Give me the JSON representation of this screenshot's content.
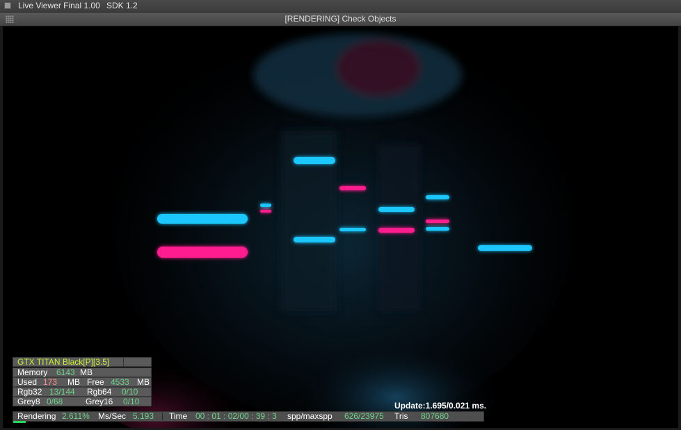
{
  "menubar": {
    "app_name": "Live Viewer Final 1.00",
    "sdk": "SDK 1.2"
  },
  "window": {
    "title": "[RENDERING] Check Objects"
  },
  "gpu_panel": {
    "gpu_name": "GTX TITAN Black[P][3.5]",
    "memory_label": "Memory",
    "memory_value": "6143",
    "memory_unit": "MB",
    "used_label": "Used",
    "used_value": "173",
    "used_unit": "MB",
    "free_label": "Free",
    "free_value": "4533",
    "free_unit": "MB",
    "rgb32_label": "Rgb32",
    "rgb32_value": "13/144",
    "rgb64_label": "Rgb64",
    "rgb64_value": "0/10",
    "grey8_label": "Grey8",
    "grey8_value": "0/68",
    "grey16_label": "Grey16",
    "grey16_value": "0/10"
  },
  "status": {
    "update_text": "Update:1.695/0.021 ms.",
    "rendering_label": "Rendering",
    "rendering_value": "2.611%",
    "mssec_label": "Ms/Sec",
    "mssec_value": "5.193",
    "time_label": "Time",
    "time_value": "00 : 01 : 02/00 : 39 : 3",
    "spp_label": "spp/maxspp",
    "spp_value": "626/23975",
    "tris_label": "Tris",
    "tris_value": "807680",
    "progress_fraction": 0.026
  },
  "colors": {
    "cyan": "#1fc6ff",
    "magenta": "#ff1f8e",
    "status_green": "#6fd38c",
    "gpu_yellow": "#c9f03a"
  }
}
